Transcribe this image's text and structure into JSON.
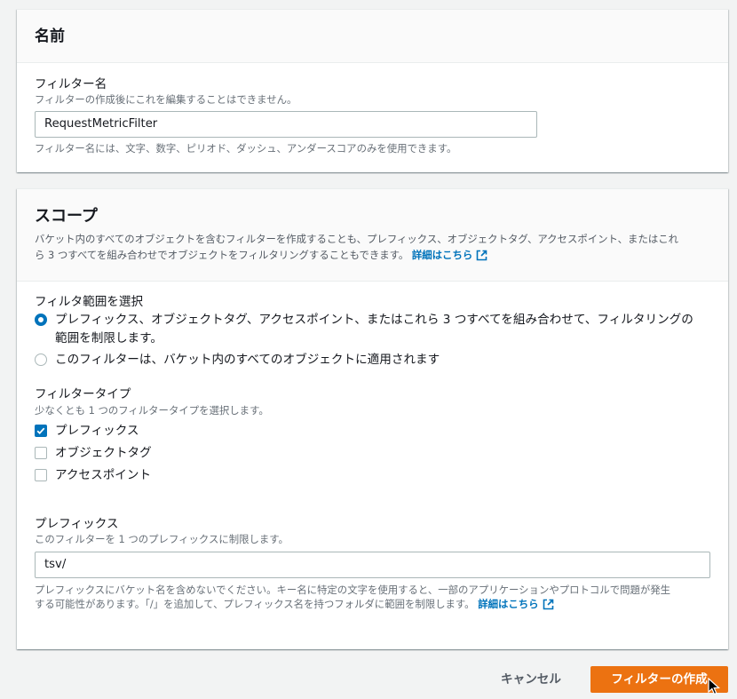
{
  "name_section": {
    "title": "名前",
    "filter_name_label": "フィルター名",
    "filter_name_desc": "フィルターの作成後にこれを編集することはできません。",
    "filter_name_value": "RequestMetricFilter",
    "filter_name_constraint": "フィルター名には、文字、数字、ピリオド、ダッシュ、アンダースコアのみを使用できます。"
  },
  "scope_section": {
    "title": "スコープ",
    "desc_line1": "バケット内のすべてのオブジェクトを含むフィルターを作成することも、プレフィックス、オブジェクトタグ、アクセスポイント、またはこれ",
    "desc_line2": "ら 3 つすべてを組み合わせでオブジェクトをフィルタリングすることもできます。",
    "learn_more": "詳細はこちら",
    "range_label": "フィルタ範囲を選択",
    "radio_options": [
      {
        "label_line1": "プレフィックス、オブジェクトタグ、アクセスポイント、またはこれら 3 つすべてを組み合わせて、フィルタリングの",
        "label_line2": "範囲を制限します。",
        "selected": true
      },
      {
        "label_line1": "このフィルターは、バケット内のすべてのオブジェクトに適用されます",
        "label_line2": "",
        "selected": false
      }
    ],
    "filter_type_label": "フィルタータイプ",
    "filter_type_desc": "少なくとも 1 つのフィルタータイプを選択します。",
    "filter_types": [
      {
        "label": "プレフィックス",
        "checked": true
      },
      {
        "label": "オブジェクトタグ",
        "checked": false
      },
      {
        "label": "アクセスポイント",
        "checked": false
      }
    ],
    "prefix_label": "プレフィックス",
    "prefix_desc": "このフィルターを 1 つのプレフィックスに制限します。",
    "prefix_value": "tsv/",
    "prefix_warning_line1": "プレフィックスにバケット名を含めないでください。キー名に特定の文字を使用すると、一部のアプリケーションやプロトコルで問題が発生",
    "prefix_warning_line2": "する可能性があります。「/」を追加して、プレフィックス名を持つフォルダに範囲を制限します。",
    "prefix_learn_more": "詳細はこちら"
  },
  "footer": {
    "cancel_label": "キャンセル",
    "create_label": "フィルターの作成"
  },
  "colors": {
    "primary": "#ec7211",
    "link": "#0073bb",
    "background": "#f2f3f3"
  },
  "icons": [
    "external-link-icon",
    "checkmark-icon",
    "mouse-cursor-icon"
  ]
}
